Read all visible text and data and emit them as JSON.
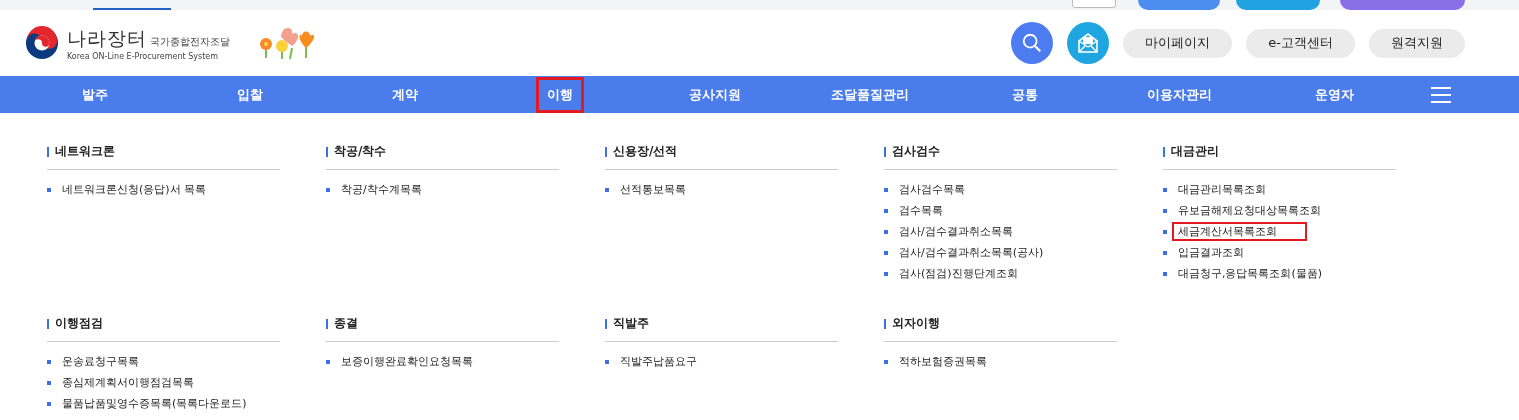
{
  "header": {
    "logo_title": "나라장터",
    "logo_subtitle": "국가종합전자조달",
    "logo_english": "Korea ON-Line E-Procurement System",
    "buttons": [
      "마이페이지",
      "e-고객센터",
      "원격지원"
    ]
  },
  "nav": [
    {
      "label": "발주",
      "selected": false
    },
    {
      "label": "입찰",
      "selected": false
    },
    {
      "label": "계약",
      "selected": false
    },
    {
      "label": "이행",
      "selected": true
    },
    {
      "label": "공사지원",
      "selected": false
    },
    {
      "label": "조달품질관리",
      "selected": false
    },
    {
      "label": "공통",
      "selected": false
    },
    {
      "label": "이용자관리",
      "selected": false
    },
    {
      "label": "운영자",
      "selected": false
    }
  ],
  "menu_rows": [
    [
      {
        "title": "네트워크론",
        "items": [
          {
            "label": "네트워크론신청(응답)서 목록",
            "selected": false
          }
        ]
      },
      {
        "title": "착공/착수",
        "items": [
          {
            "label": "착공/착수계목록",
            "selected": false
          }
        ]
      },
      {
        "title": "신용장/선적",
        "items": [
          {
            "label": "선적통보목록",
            "selected": false
          }
        ]
      },
      {
        "title": "검사검수",
        "items": [
          {
            "label": "검사검수목록",
            "selected": false
          },
          {
            "label": "검수목록",
            "selected": false
          },
          {
            "label": "검사/검수결과취소목록",
            "selected": false
          },
          {
            "label": "검사/검수결과취소목록(공사)",
            "selected": false
          },
          {
            "label": "검사(점검)진행단계조회",
            "selected": false
          }
        ]
      },
      {
        "title": "대금관리",
        "items": [
          {
            "label": "대금관리목록조회",
            "selected": false
          },
          {
            "label": "유보금해제요청대상목록조회",
            "selected": false
          },
          {
            "label": "세금계산서목록조회",
            "selected": true
          },
          {
            "label": "입금결과조회",
            "selected": false
          },
          {
            "label": "대금청구,응답목록조회(물품)",
            "selected": false
          }
        ]
      }
    ],
    [
      {
        "title": "이행점검",
        "items": [
          {
            "label": "운송료청구목록",
            "selected": false
          },
          {
            "label": "종심제계획서이행점검목록",
            "selected": false
          },
          {
            "label": "물품납품및영수증목록(목록다운로드)",
            "selected": false
          }
        ]
      },
      {
        "title": "종결",
        "items": [
          {
            "label": "보증이행완료확인요청목록",
            "selected": false
          }
        ]
      },
      {
        "title": "직발주",
        "items": [
          {
            "label": "직발주납품요구",
            "selected": false
          }
        ]
      },
      {
        "title": "외자이행",
        "items": [
          {
            "label": "적하보험증권목록",
            "selected": false
          }
        ]
      }
    ]
  ]
}
